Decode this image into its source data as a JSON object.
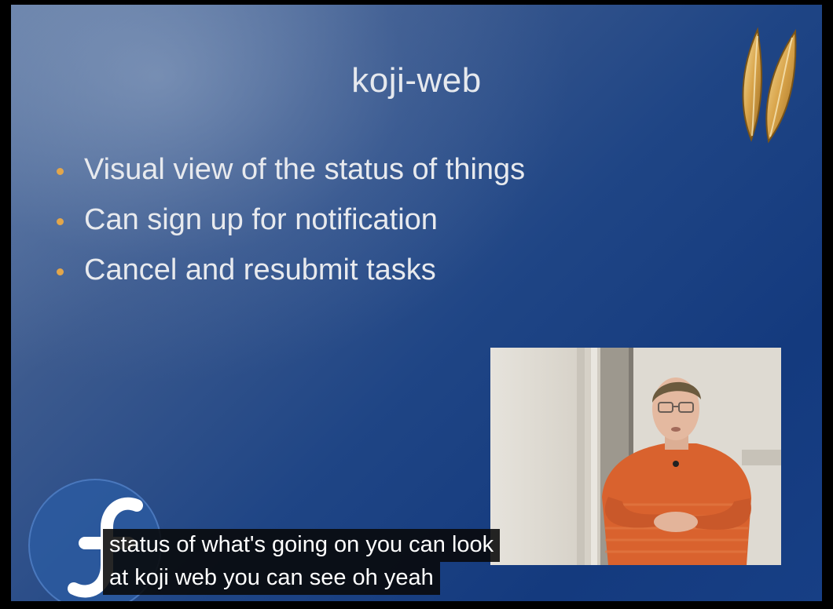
{
  "slide": {
    "title": "koji-web",
    "bullets": [
      "Visual view of the status of things",
      "Can sign up for notification",
      "Cancel and resubmit tasks"
    ],
    "bullet_color": "#e2a64b"
  },
  "logos": {
    "top_right": "wheat-logo-icon",
    "bottom_left": "fedora-logo-icon"
  },
  "captions": {
    "line1": "status of what's going on you can look",
    "line2": "at koji web you can see oh yeah"
  },
  "colors": {
    "slide_blue": "#1f4585",
    "shirt_orange": "#d9622e"
  }
}
